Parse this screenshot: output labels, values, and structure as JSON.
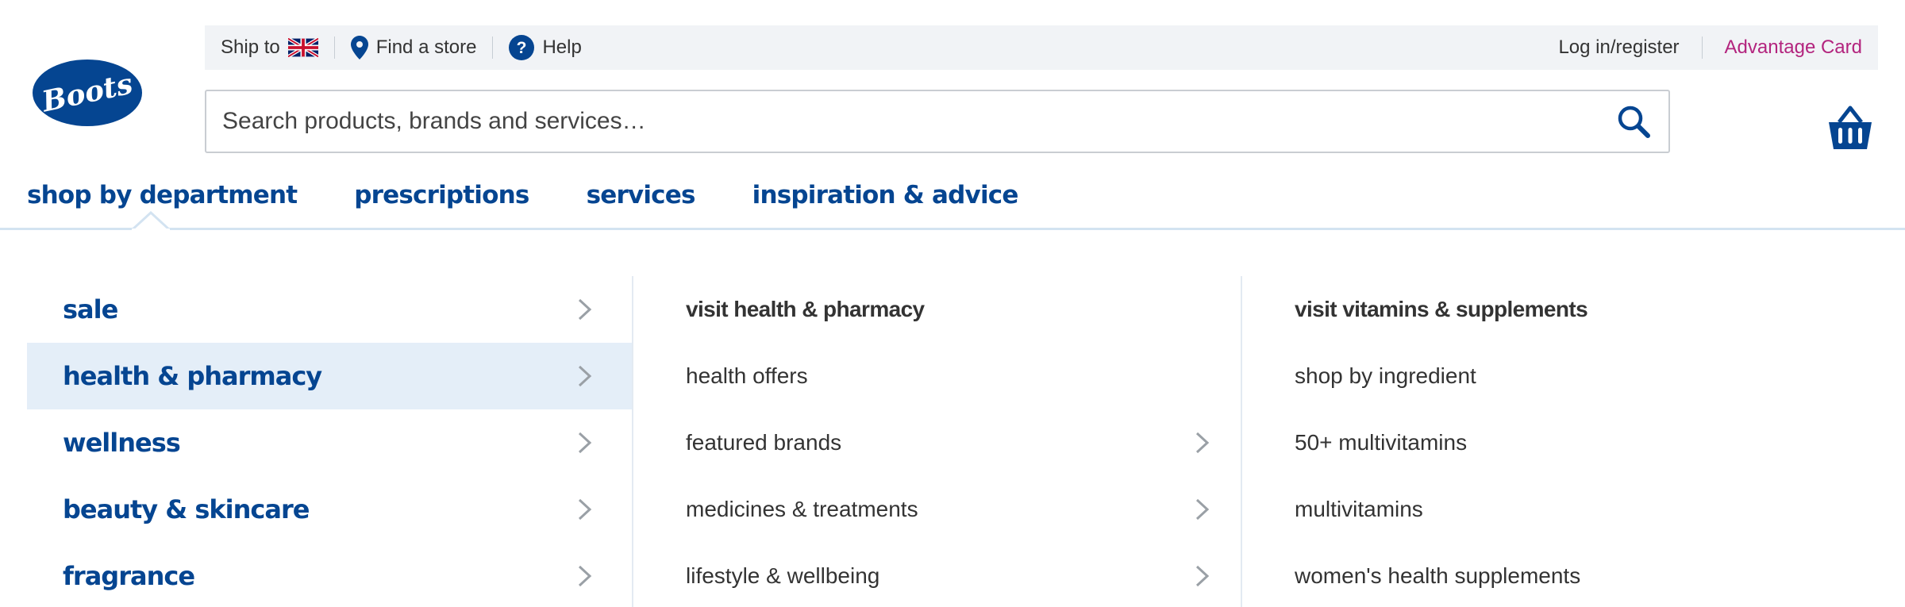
{
  "brand": {
    "logo_text": "Boots",
    "primary_color": "#054591",
    "accent_color": "#b3247e"
  },
  "utility": {
    "ship_to_label": "Ship to",
    "find_store_label": "Find a store",
    "help_label": "Help",
    "login_label": "Log in/register",
    "advantage_label": "Advantage Card"
  },
  "search": {
    "placeholder": "Search products, brands and services…",
    "value": ""
  },
  "nav": {
    "tabs": [
      {
        "label": "shop by department",
        "active": true
      },
      {
        "label": "prescriptions"
      },
      {
        "label": "services"
      },
      {
        "label": "inspiration & advice"
      }
    ]
  },
  "menu": {
    "departments": [
      {
        "label": "sale"
      },
      {
        "label": "health & pharmacy",
        "active": true
      },
      {
        "label": "wellness"
      },
      {
        "label": "beauty & skincare"
      },
      {
        "label": "fragrance"
      }
    ],
    "health": [
      {
        "label": "visit health & pharmacy",
        "heading": true
      },
      {
        "label": "health offers"
      },
      {
        "label": "featured brands",
        "has_children": true
      },
      {
        "label": "medicines & treatments",
        "has_children": true
      },
      {
        "label": "lifestyle & wellbeing",
        "has_children": true
      }
    ],
    "vitamins": [
      {
        "label": "visit vitamins & supplements",
        "heading": true
      },
      {
        "label": "shop by ingredient"
      },
      {
        "label": "50+ multivitamins"
      },
      {
        "label": "multivitamins"
      },
      {
        "label": "women's health supplements"
      }
    ]
  },
  "icons": {
    "flag": "uk-flag-icon",
    "store": "map-pin-icon",
    "help": "question-circle-icon",
    "search": "search-icon",
    "basket": "basket-icon",
    "chevron": "chevron-right-icon"
  }
}
